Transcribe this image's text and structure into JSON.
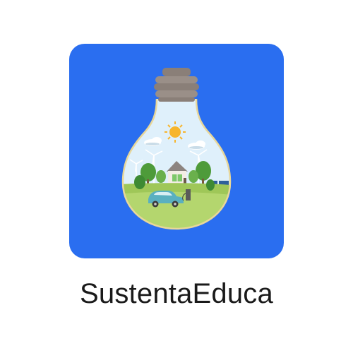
{
  "app": {
    "name": "SustentaEduca",
    "icon": "lightbulb-eco-landscape-icon"
  },
  "colors": {
    "icon_background": "#2a6ef0",
    "label_text": "#1a1a1a",
    "bulb_cap": "#8a7f78",
    "bulb_outline": "#e8d79a",
    "sky": "#dff0fb",
    "grass": "#9fc758",
    "sun": "#f7b52c",
    "car": "#5ab0c0"
  }
}
